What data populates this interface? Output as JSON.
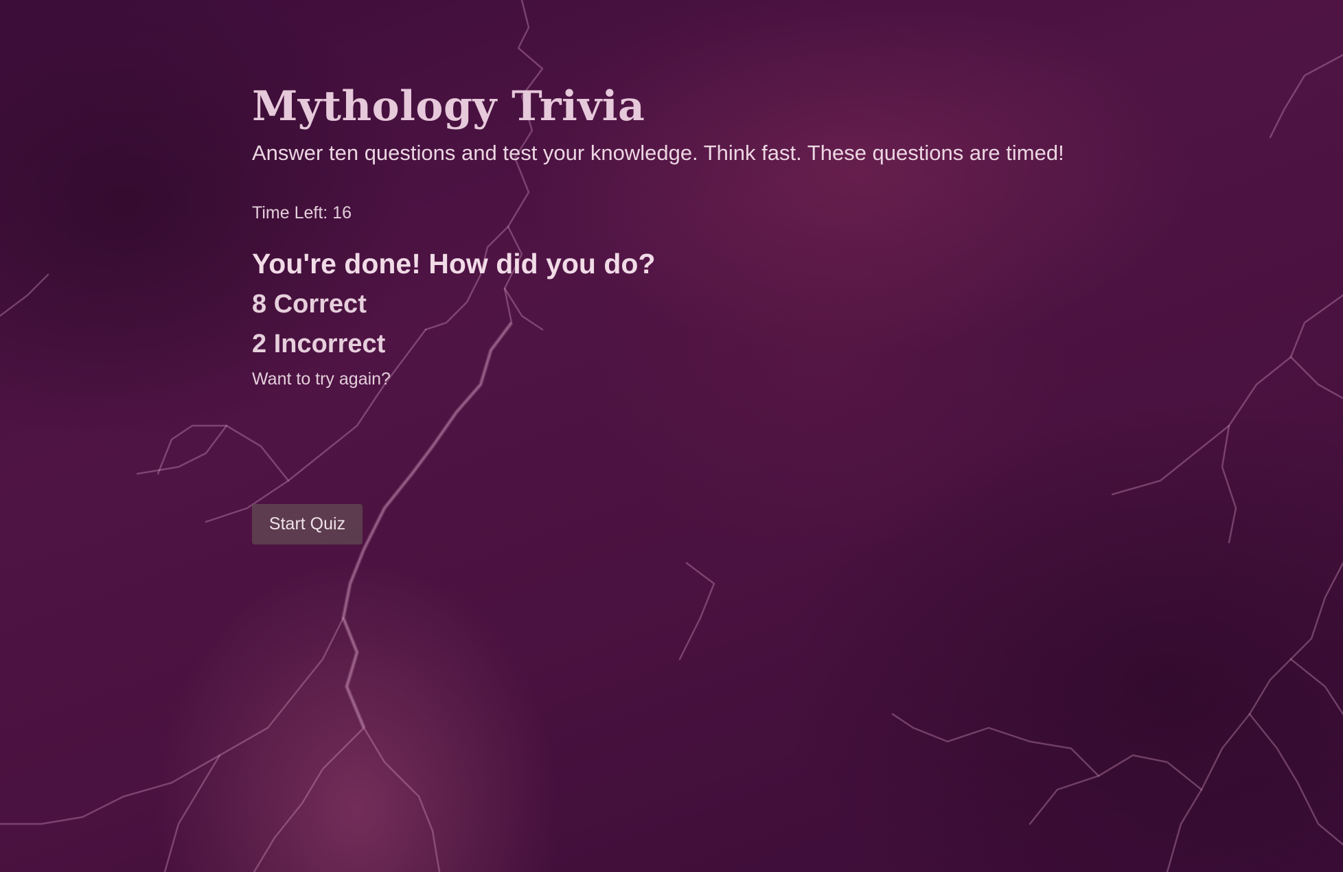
{
  "quiz": {
    "title": "Mythology Trivia",
    "subtitle": "Answer ten questions and test your knowledge. Think fast. These questions are timed!",
    "timer_text": "Time Left: 16",
    "result_heading": "You're done! How did you do?",
    "correct_text": "8 Correct",
    "incorrect_text": "2 Incorrect",
    "try_again_text": "Want to try again?",
    "start_button_label": "Start Quiz"
  },
  "theme": {
    "background": "#4a1240",
    "text": "#ecd6e2",
    "button_background": "#5f4650"
  }
}
